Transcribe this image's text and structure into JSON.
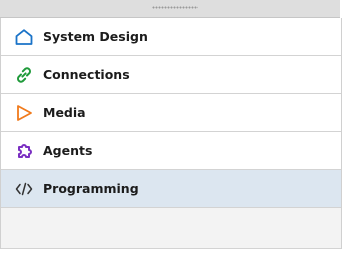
{
  "sidebar": {
    "items": [
      {
        "label": "System Design",
        "icon": "house-outline-icon",
        "color": "#1a73c8",
        "selected": false
      },
      {
        "label": "Connections",
        "icon": "link-icon",
        "color": "#1f9a3a",
        "selected": false
      },
      {
        "label": "Media",
        "icon": "play-outline-icon",
        "color": "#f07a1c",
        "selected": false
      },
      {
        "label": "Agents",
        "icon": "puzzle-icon",
        "color": "#7b2fc2",
        "selected": false
      },
      {
        "label": "Programming",
        "icon": "code-brackets-icon",
        "color": "#333333",
        "selected": true
      }
    ]
  },
  "colors": {
    "selected_background": "#dce6f0",
    "divider": "#d3d3d3"
  }
}
